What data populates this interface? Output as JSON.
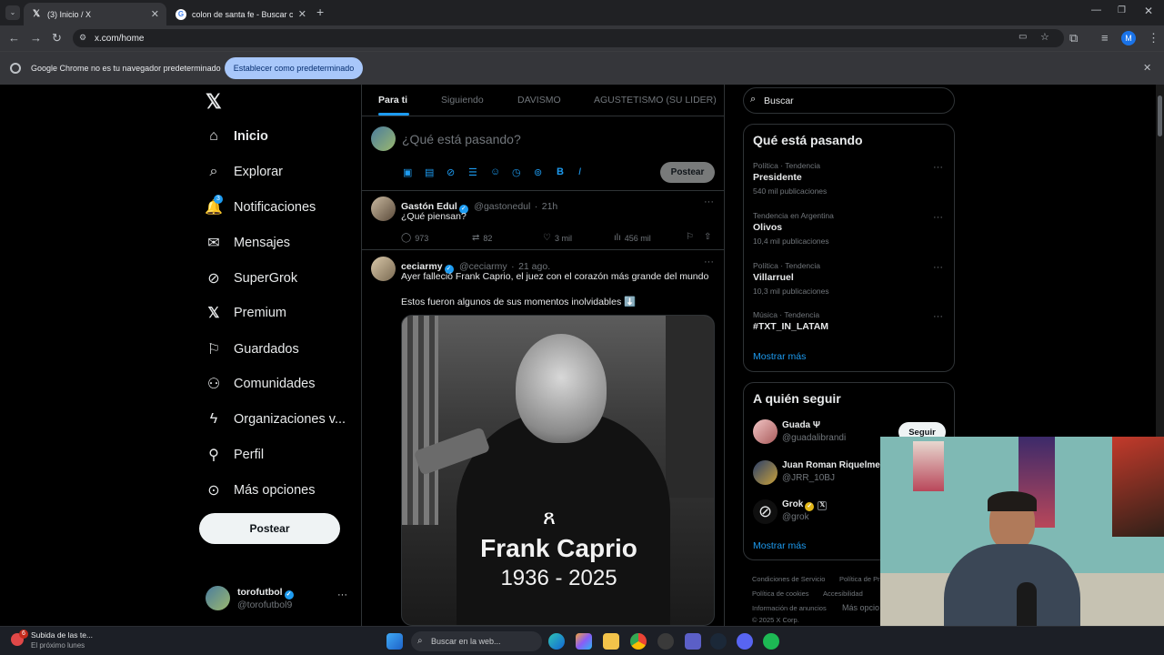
{
  "browser": {
    "tabs": [
      {
        "title": "(3) Inicio / X",
        "active": true
      },
      {
        "title": "colon de santa fe - Buscar con Google",
        "active": false
      }
    ],
    "url": "x.com/home",
    "profile_initial": "M",
    "infobar_text": "Google Chrome no es tu navegador predeterminado",
    "infobar_button": "Establecer como predeterminado"
  },
  "sidebar": {
    "items": [
      {
        "label": "Inicio",
        "icon": "home-icon"
      },
      {
        "label": "Explorar",
        "icon": "search-icon"
      },
      {
        "label": "Notificaciones",
        "icon": "bell-icon",
        "badge": "3"
      },
      {
        "label": "Mensajes",
        "icon": "mail-icon"
      },
      {
        "label": "SuperGrok",
        "icon": "grok-icon"
      },
      {
        "label": "Premium",
        "icon": "x-logo-icon"
      },
      {
        "label": "Guardados",
        "icon": "bookmark-icon"
      },
      {
        "label": "Comunidades",
        "icon": "people-icon"
      },
      {
        "label": "Organizaciones v...",
        "icon": "lightning-icon"
      },
      {
        "label": "Perfil",
        "icon": "person-icon"
      },
      {
        "label": "Más opciones",
        "icon": "more-circle-icon"
      }
    ],
    "post_button": "Postear",
    "account": {
      "name": "torofutbol",
      "handle": "@torofutbol9"
    }
  },
  "feed": {
    "tabs": [
      "Para ti",
      "Siguiendo",
      "DAVISMO",
      "AGUSTETISMO (SU LIDER)"
    ],
    "composer_placeholder": "¿Qué está pasando?",
    "composer_button": "Postear",
    "tweets": [
      {
        "name": "Gastón Edul",
        "handle": "@gastonedul",
        "time": "21h",
        "text": "¿Qué piensan?",
        "replies": "973",
        "reposts": "82",
        "likes": "3 mil",
        "views": "456 mil"
      },
      {
        "name": "ceciarmy",
        "handle": "@ceciarmy",
        "time": "21 ago.",
        "text": "Ayer falleció Frank Caprio, el juez con el corazón más grande del mundo",
        "text2": "Estos fueron algunos de sus momentos inolvidables ⬇️",
        "image_title": "Frank Caprio",
        "image_years": "1936 - 2025"
      }
    ]
  },
  "right": {
    "search_placeholder": "Buscar",
    "trends_title": "Qué está pasando",
    "trends": [
      {
        "category": "Política · Tendencia",
        "name": "Presidente",
        "count": "540 mil publicaciones"
      },
      {
        "category": "Tendencia en Argentina",
        "name": "Olivos",
        "count": "10,4 mil publicaciones"
      },
      {
        "category": "Política · Tendencia",
        "name": "Villarruel",
        "count": "10,3 mil publicaciones"
      },
      {
        "category": "Música · Tendencia",
        "name": "#TXT_IN_LATAM",
        "count": ""
      }
    ],
    "trends_more": "Mostrar más",
    "follow_title": "A quién seguir",
    "follow": [
      {
        "name": "Guada Ψ",
        "handle": "@guadalibrandi"
      },
      {
        "name": "Juan Roman Riquelme",
        "handle": "@JRR_10BJ"
      },
      {
        "name": "Grok",
        "handle": "@grok"
      }
    ],
    "follow_button": "Seguir",
    "follow_more": "Mostrar más",
    "footer": [
      "Condiciones de Servicio",
      "Política de Pr",
      "Política de cookies",
      "Accesibilidad",
      "Información de anuncios",
      "Más opcio",
      "© 2025 X Corp."
    ]
  },
  "taskbar": {
    "notification_title": "Subida de las te...",
    "notification_sub": "El próximo lunes",
    "notification_badge": "6",
    "search_placeholder": "Buscar en la web..."
  }
}
